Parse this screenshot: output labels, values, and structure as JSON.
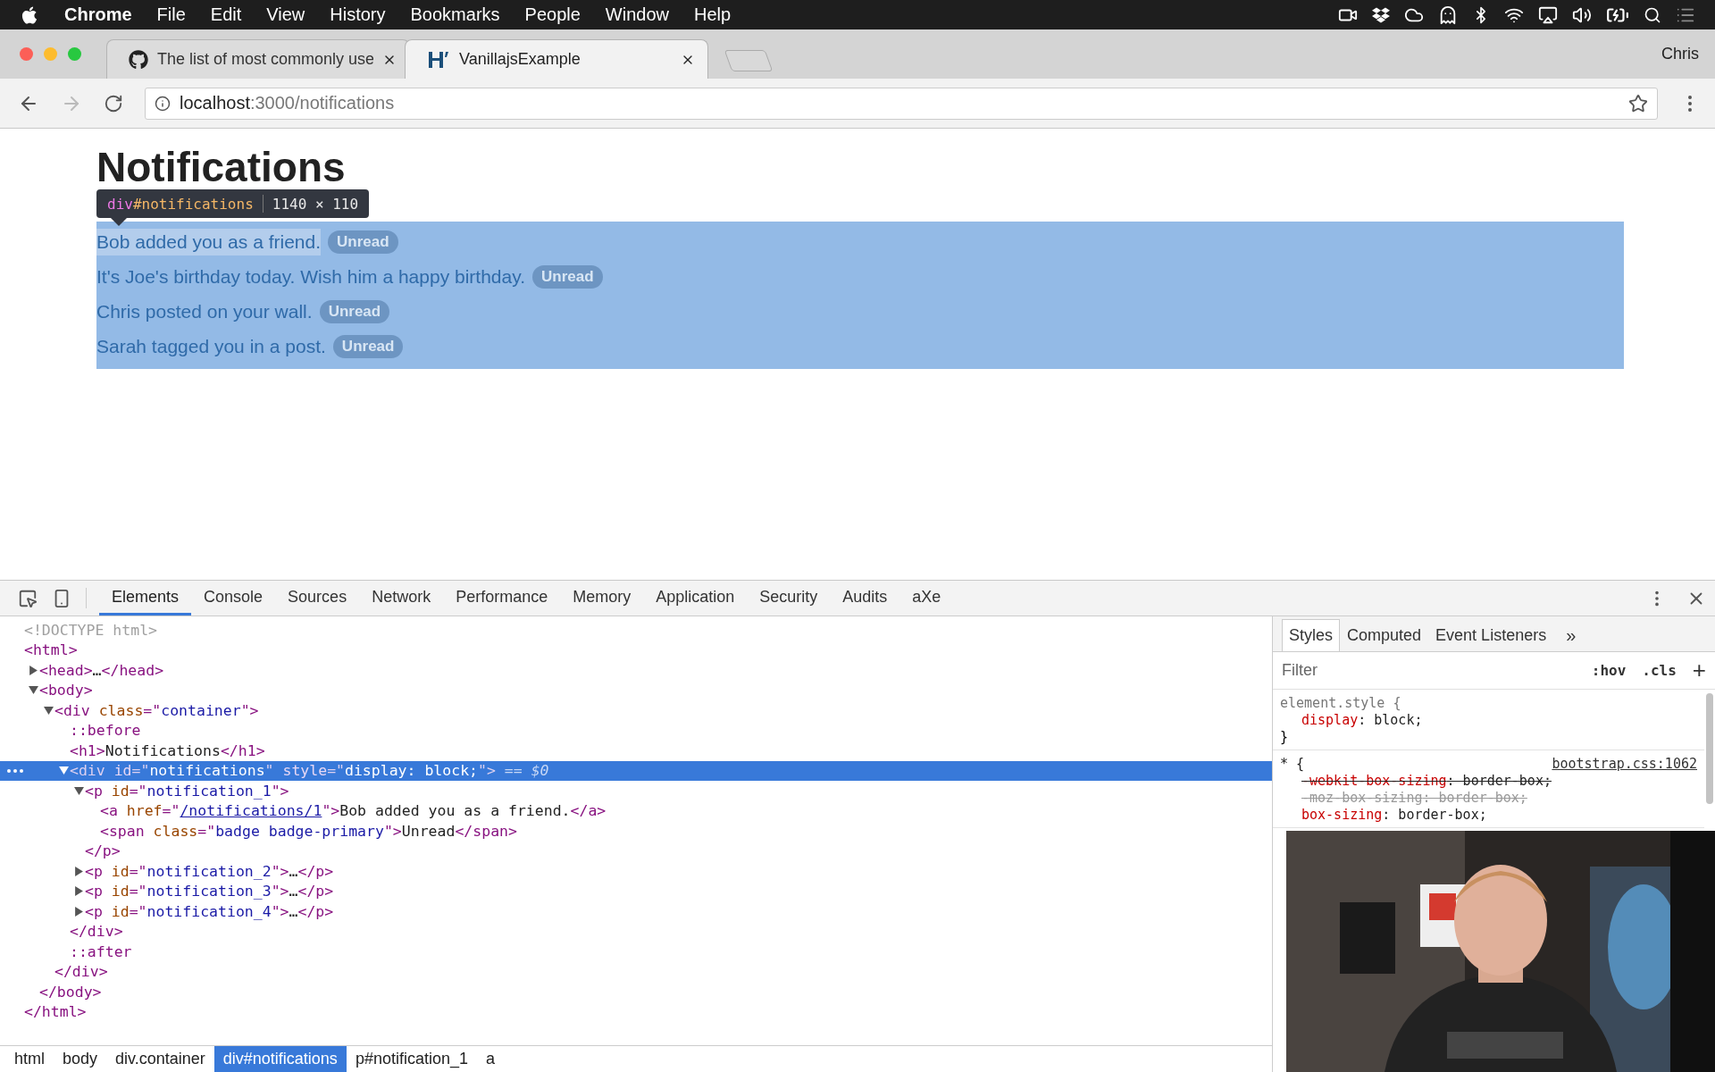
{
  "menu_bar": {
    "app": "Chrome",
    "items": [
      "File",
      "Edit",
      "View",
      "History",
      "Bookmarks",
      "People",
      "Window",
      "Help"
    ]
  },
  "tabs": [
    {
      "title": "The list of most commonly use",
      "selected": false,
      "kind": "github"
    },
    {
      "title": "VanillajsExample",
      "selected": true,
      "kind": "h"
    }
  ],
  "profile": "Chris",
  "address": {
    "host": "localhost",
    "path": ":3000/notifications"
  },
  "page": {
    "heading": "Notifications",
    "tooltip": {
      "tag": "div",
      "id": "#notifications",
      "size": "1140 × 110"
    },
    "notifications": [
      {
        "text": "Bob added you as a friend.",
        "badge": "Unread",
        "hovered": true
      },
      {
        "text": "It's Joe's birthday today. Wish him a happy birthday.",
        "badge": "Unread",
        "hovered": false
      },
      {
        "text": "Chris posted on your wall.",
        "badge": "Unread",
        "hovered": false
      },
      {
        "text": "Sarah tagged you in a post.",
        "badge": "Unread",
        "hovered": false
      }
    ]
  },
  "devtools": {
    "tabs": [
      {
        "label": "Elements",
        "selected": true
      },
      {
        "label": "Console",
        "selected": false
      },
      {
        "label": "Sources",
        "selected": false
      },
      {
        "label": "Network",
        "selected": false
      },
      {
        "label": "Performance",
        "selected": false
      },
      {
        "label": "Memory",
        "selected": false
      },
      {
        "label": "Application",
        "selected": false
      },
      {
        "label": "Security",
        "selected": false
      },
      {
        "label": "Audits",
        "selected": false
      },
      {
        "label": "aXe",
        "selected": false
      }
    ],
    "tree": [
      {
        "selected": false,
        "tokens": [
          {
            "kind": "doctype",
            "text": "<!DOCTYPE html>"
          }
        ]
      },
      {
        "selected": false,
        "tokens": [
          {
            "kind": "tag",
            "text": "<html>"
          }
        ],
        "close": [
          {
            "kind": "tag",
            "text": "</html>"
          }
        ],
        "children": [
          {
            "selected": false,
            "expanded": false,
            "tokens": [
              {
                "kind": "tag",
                "text": "<head>"
              },
              {
                "kind": "text",
                "text": "…"
              },
              {
                "kind": "tag",
                "text": "</head>"
              }
            ]
          },
          {
            "selected": false,
            "expanded": true,
            "tokens": [
              {
                "kind": "tag",
                "text": "<body>"
              }
            ],
            "close": [
              {
                "kind": "tag",
                "text": "</body>"
              }
            ],
            "children": [
              {
                "selected": false,
                "expanded": true,
                "tokens": [
                  {
                    "kind": "tag",
                    "text": "<div"
                  },
                  {
                    "kind": "attr",
                    "text": " class"
                  },
                  {
                    "kind": "tag",
                    "text": "=\""
                  },
                  {
                    "kind": "value",
                    "text": "container"
                  },
                  {
                    "kind": "tag",
                    "text": "\">"
                  }
                ],
                "close": [
                  {
                    "kind": "tag",
                    "text": "</div>"
                  }
                ],
                "children": [
                  {
                    "selected": false,
                    "tokens": [
                      {
                        "kind": "tag",
                        "text": "::before"
                      }
                    ]
                  },
                  {
                    "selected": false,
                    "tokens": [
                      {
                        "kind": "tag",
                        "text": "<h1>"
                      },
                      {
                        "kind": "text",
                        "text": "Notifications"
                      },
                      {
                        "kind": "tag",
                        "text": "</h1>"
                      }
                    ]
                  },
                  {
                    "selected": true,
                    "expanded": true,
                    "tokens": [
                      {
                        "kind": "tag",
                        "text": "<div"
                      },
                      {
                        "kind": "attr",
                        "text": " id"
                      },
                      {
                        "kind": "tag",
                        "text": "=\""
                      },
                      {
                        "kind": "value",
                        "text": "notifications"
                      },
                      {
                        "kind": "tag",
                        "text": "\""
                      },
                      {
                        "kind": "attr",
                        "text": " style"
                      },
                      {
                        "kind": "tag",
                        "text": "=\""
                      },
                      {
                        "kind": "value",
                        "text": "display: block;"
                      },
                      {
                        "kind": "tag",
                        "text": "\">"
                      },
                      {
                        "kind": "ref",
                        "text": " == $0"
                      }
                    ],
                    "close": [
                      {
                        "kind": "tag",
                        "text": "</div>"
                      }
                    ],
                    "children": [
                      {
                        "selected": false,
                        "expanded": true,
                        "tokens": [
                          {
                            "kind": "tag",
                            "text": "<p"
                          },
                          {
                            "kind": "attr",
                            "text": " id"
                          },
                          {
                            "kind": "tag",
                            "text": "=\""
                          },
                          {
                            "kind": "value",
                            "text": "notification_1"
                          },
                          {
                            "kind": "tag",
                            "text": "\">"
                          }
                        ],
                        "close": [
                          {
                            "kind": "tag",
                            "text": "</p>"
                          }
                        ],
                        "children": [
                          {
                            "selected": false,
                            "tokens": [
                              {
                                "kind": "tag",
                                "text": "<a"
                              },
                              {
                                "kind": "attr",
                                "text": " href"
                              },
                              {
                                "kind": "tag",
                                "text": "=\""
                              },
                              {
                                "kind": "link",
                                "text": "/notifications/1"
                              },
                              {
                                "kind": "tag",
                                "text": "\">"
                              },
                              {
                                "kind": "text",
                                "text": "Bob added you as a friend."
                              },
                              {
                                "kind": "tag",
                                "text": "</a>"
                              }
                            ]
                          },
                          {
                            "selected": false,
                            "tokens": [
                              {
                                "kind": "tag",
                                "text": "<span"
                              },
                              {
                                "kind": "attr",
                                "text": " class"
                              },
                              {
                                "kind": "tag",
                                "text": "=\""
                              },
                              {
                                "kind": "value",
                                "text": "badge badge-primary"
                              },
                              {
                                "kind": "tag",
                                "text": "\">"
                              },
                              {
                                "kind": "text",
                                "text": "Unread"
                              },
                              {
                                "kind": "tag",
                                "text": "</span>"
                              }
                            ]
                          }
                        ]
                      },
                      {
                        "selected": false,
                        "expanded": false,
                        "tokens": [
                          {
                            "kind": "tag",
                            "text": "<p"
                          },
                          {
                            "kind": "attr",
                            "text": " id"
                          },
                          {
                            "kind": "tag",
                            "text": "=\""
                          },
                          {
                            "kind": "value",
                            "text": "notification_2"
                          },
                          {
                            "kind": "tag",
                            "text": "\">"
                          },
                          {
                            "kind": "text",
                            "text": "…"
                          },
                          {
                            "kind": "tag",
                            "text": "</p>"
                          }
                        ]
                      },
                      {
                        "selected": false,
                        "expanded": false,
                        "tokens": [
                          {
                            "kind": "tag",
                            "text": "<p"
                          },
                          {
                            "kind": "attr",
                            "text": " id"
                          },
                          {
                            "kind": "tag",
                            "text": "=\""
                          },
                          {
                            "kind": "value",
                            "text": "notification_3"
                          },
                          {
                            "kind": "tag",
                            "text": "\">"
                          },
                          {
                            "kind": "text",
                            "text": "…"
                          },
                          {
                            "kind": "tag",
                            "text": "</p>"
                          }
                        ]
                      },
                      {
                        "selected": false,
                        "expanded": false,
                        "tokens": [
                          {
                            "kind": "tag",
                            "text": "<p"
                          },
                          {
                            "kind": "attr",
                            "text": " id"
                          },
                          {
                            "kind": "tag",
                            "text": "=\""
                          },
                          {
                            "kind": "value",
                            "text": "notification_4"
                          },
                          {
                            "kind": "tag",
                            "text": "\">"
                          },
                          {
                            "kind": "text",
                            "text": "…"
                          },
                          {
                            "kind": "tag",
                            "text": "</p>"
                          }
                        ]
                      }
                    ]
                  },
                  {
                    "selected": false,
                    "tokens": [
                      {
                        "kind": "tag",
                        "text": "::after"
                      }
                    ]
                  }
                ]
              }
            ]
          }
        ]
      }
    ],
    "breadcrumbs": [
      {
        "label": "html",
        "selected": false
      },
      {
        "label": "body",
        "selected": false
      },
      {
        "label": "div.container",
        "selected": false
      },
      {
        "label": "div#notifications",
        "selected": true
      },
      {
        "label": "p#notification_1",
        "selected": false
      },
      {
        "label": "a",
        "selected": false
      }
    ],
    "sidebar": {
      "tabs": [
        {
          "label": "Styles",
          "selected": true
        },
        {
          "label": "Computed",
          "selected": false
        },
        {
          "label": "Event Listeners",
          "selected": false
        }
      ],
      "more": "»",
      "filter_placeholder": "Filter",
      "hov": ":hov",
      "cls": ".cls",
      "add": "+",
      "rules": [
        {
          "selector": "element.style {",
          "props": [
            {
              "name": "display",
              "value": ": block;",
              "struck": false,
              "invalid": false
            }
          ],
          "end": "}"
        },
        {
          "selector": "* {",
          "source": "bootstrap.css:1062",
          "props": [
            {
              "name": "-webkit-box-sizing",
              "value": ": border-box;",
              "struck": true,
              "invalid": false
            },
            {
              "name": "-moz-box-sizing",
              "value": ": border-box;",
              "struck": true,
              "invalid": true
            },
            {
              "name": "box-sizing",
              "value": ": border-box;",
              "struck": false,
              "invalid": false
            }
          ]
        }
      ]
    }
  }
}
